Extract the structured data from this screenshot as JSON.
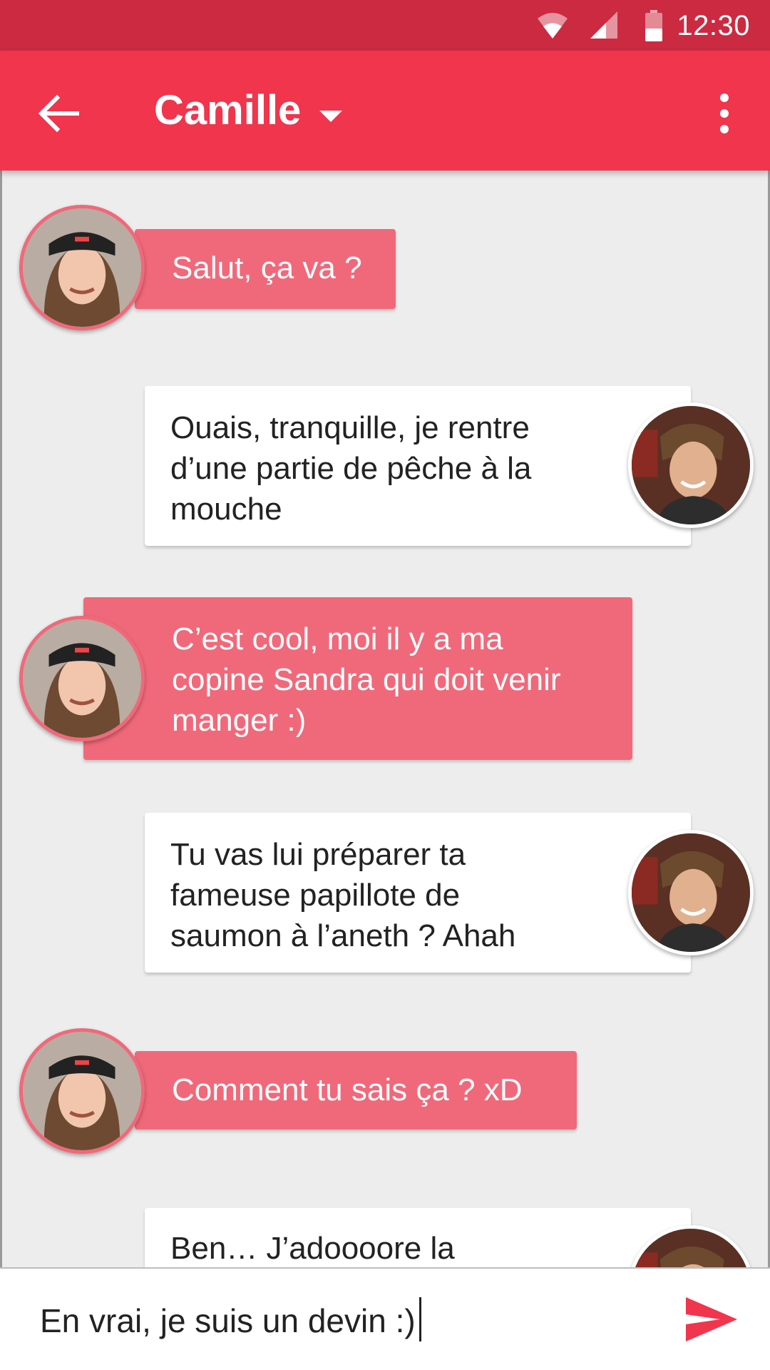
{
  "status_bar": {
    "time": "12:30"
  },
  "app_bar": {
    "title": "Camille"
  },
  "messages": [
    {
      "from": "Camille",
      "lines": [
        "Salut, ça va ?"
      ]
    },
    {
      "from": "me",
      "lines": [
        "Ouais, tranquille, je rentre",
        "d’une partie de pêche à la",
        "mouche"
      ]
    },
    {
      "from": "Camille",
      "lines": [
        "C’est cool, moi il y a ma",
        "copine Sandra qui doit venir",
        "manger :)"
      ]
    },
    {
      "from": "me",
      "lines": [
        "Tu vas lui préparer ta",
        "fameuse papillote de",
        "saumon à l’aneth ? Ahah"
      ]
    },
    {
      "from": "Camille",
      "lines": [
        "Comment tu sais ça ? xD"
      ]
    },
    {
      "from": "me",
      "lines": [
        "Ben… J’adoooore la"
      ]
    }
  ],
  "composer": {
    "value": "En vrai, je suis un devin :)"
  },
  "colors": {
    "status_bar": "#cc2a41",
    "app_bar": "#f0354d",
    "incoming_bubble": "#f0697a",
    "outgoing_bubble": "#ffffff",
    "send_icon": "#f0354d"
  },
  "icons": {
    "back": "arrow-left-icon",
    "title_dropdown": "caret-down-icon",
    "menu": "more-vert-icon",
    "send": "send-icon",
    "wifi": "wifi-icon",
    "signal": "signal-icon",
    "battery": "battery-icon"
  }
}
